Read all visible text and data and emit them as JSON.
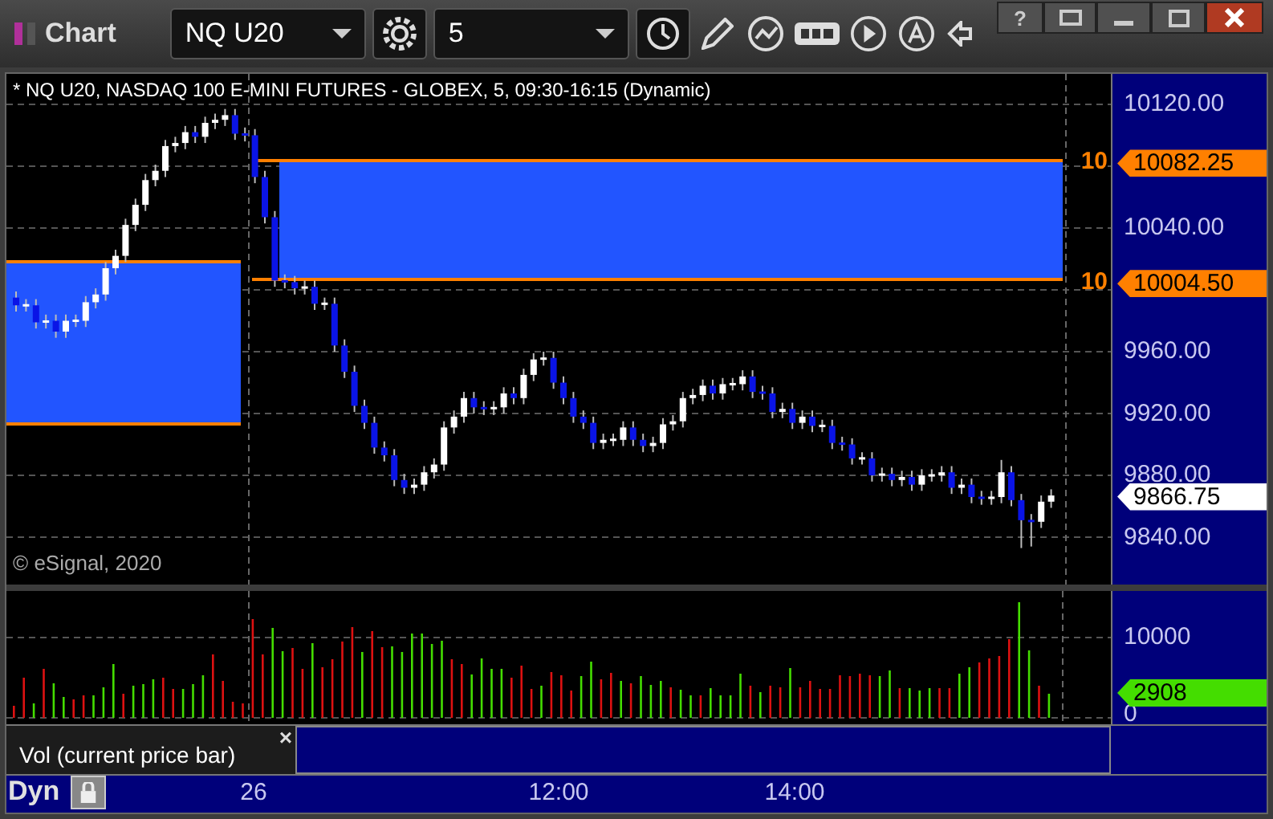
{
  "window": {
    "title": "Chart",
    "help": "?"
  },
  "toolbar": {
    "symbol": "NQ U20",
    "interval": "5"
  },
  "price_pane": {
    "title": "* NQ U20, NASDAQ 100 E-MINI FUTURES - GLOBEX, 5, 09:30-16:15 (Dynamic)",
    "copyright": "© eSignal, 2020",
    "level_tags": [
      {
        "cut_label": "10",
        "price": "10082.25"
      },
      {
        "cut_label": "10",
        "price": "10004.50"
      }
    ],
    "last_price": "9866.75",
    "chart_data": {
      "type": "candlestick",
      "ylim": [
        9809.4,
        10139.7
      ],
      "grid": true,
      "yticks": [
        {
          "value": 10120,
          "label": "10120.00"
        },
        {
          "value": 10040,
          "label": "10040.00"
        },
        {
          "value": 9960,
          "label": "9960.00"
        },
        {
          "value": 9920,
          "label": "9920.00"
        },
        {
          "value": 9880,
          "label": "9880.00"
        },
        {
          "value": 9840,
          "label": "9840.00"
        }
      ],
      "ohlc": [
        [
          9995,
          9999,
          9986,
          9990
        ],
        [
          9990,
          9994,
          9986,
          9990
        ],
        [
          9990,
          9994,
          9975,
          9979
        ],
        [
          9979,
          9984,
          9975,
          9980
        ],
        [
          9980,
          9984,
          9969,
          9973
        ],
        [
          9973,
          9984,
          9969,
          9980
        ],
        [
          9980,
          9984,
          9976,
          9980
        ],
        [
          9980,
          9996,
          9976,
          9992
        ],
        [
          9992,
          10001,
          9988,
          9997
        ],
        [
          9997,
          10018,
          9993,
          10014
        ],
        [
          10014,
          10026,
          10010,
          10022
        ],
        [
          10022,
          10046,
          10018,
          10042
        ],
        [
          10042,
          10059,
          10038,
          10055
        ],
        [
          10055,
          10075,
          10051,
          10071
        ],
        [
          10071,
          10081,
          10067,
          10077
        ],
        [
          10077,
          10097,
          10073,
          10093
        ],
        [
          10093,
          10099,
          10089,
          10095
        ],
        [
          10095,
          10106,
          10091,
          10102
        ],
        [
          10102,
          10106,
          10095,
          10099
        ],
        [
          10099,
          10112,
          10095,
          10108
        ],
        [
          10108,
          10114,
          10104,
          10110
        ],
        [
          10110,
          10117,
          10106,
          10113
        ],
        [
          10113,
          10117,
          10097,
          10101
        ],
        [
          10101,
          10105,
          10096,
          10100
        ],
        [
          10100,
          10104,
          10069,
          10073
        ],
        [
          10073,
          10077,
          10043,
          10047
        ],
        [
          10047,
          10051,
          10002,
          10006
        ],
        [
          10006,
          10010,
          10001,
          10005
        ],
        [
          10005,
          10009,
          9997,
          10001
        ],
        [
          10001,
          10006,
          9997,
          10002
        ],
        [
          10002,
          10006,
          9987,
          9991
        ],
        [
          9991,
          9995,
          9987,
          9991
        ],
        [
          9991,
          9995,
          9960,
          9964
        ],
        [
          9964,
          9968,
          9943,
          9947
        ],
        [
          9947,
          9951,
          9921,
          9925
        ],
        [
          9925,
          9929,
          9910,
          9914
        ],
        [
          9914,
          9918,
          9894,
          9898
        ],
        [
          9898,
          9902,
          9889,
          9893
        ],
        [
          9893,
          9897,
          9873,
          9877
        ],
        [
          9877,
          9881,
          9868,
          9872
        ],
        [
          9872,
          9878,
          9868,
          9874
        ],
        [
          9874,
          9886,
          9870,
          9882
        ],
        [
          9882,
          9891,
          9878,
          9887
        ],
        [
          9887,
          9915,
          9883,
          9911
        ],
        [
          9911,
          9922,
          9907,
          9918
        ],
        [
          9918,
          9934,
          9914,
          9930
        ],
        [
          9930,
          9934,
          9920,
          9924
        ],
        [
          9924,
          9928,
          9919,
          9923
        ],
        [
          9923,
          9928,
          9919,
          9924
        ],
        [
          9924,
          9937,
          9920,
          9933
        ],
        [
          9933,
          9937,
          9926,
          9930
        ],
        [
          9930,
          9949,
          9926,
          9945
        ],
        [
          9945,
          9959,
          9941,
          9955
        ],
        [
          9955,
          9960,
          9951,
          9956
        ],
        [
          9956,
          9960,
          9936,
          9940
        ],
        [
          9940,
          9944,
          9926,
          9930
        ],
        [
          9930,
          9934,
          9914,
          9918
        ],
        [
          9918,
          9922,
          9910,
          9914
        ],
        [
          9914,
          9918,
          9897,
          9901
        ],
        [
          9901,
          9907,
          9897,
          9903
        ],
        [
          9903,
          9907,
          9899,
          9903
        ],
        [
          9903,
          9915,
          9899,
          9911
        ],
        [
          9911,
          9915,
          9899,
          9903
        ],
        [
          9903,
          9907,
          9895,
          9899
        ],
        [
          9899,
          9905,
          9895,
          9901
        ],
        [
          9901,
          9917,
          9897,
          9913
        ],
        [
          9913,
          9919,
          9909,
          9915
        ],
        [
          9915,
          9934,
          9911,
          9930
        ],
        [
          9930,
          9936,
          9926,
          9932
        ],
        [
          9932,
          9942,
          9928,
          9938
        ],
        [
          9938,
          9942,
          9929,
          9933
        ],
        [
          9933,
          9943,
          9929,
          9939
        ],
        [
          9939,
          9943,
          9935,
          9939
        ],
        [
          9939,
          9948,
          9935,
          9944
        ],
        [
          9944,
          9948,
          9930,
          9934
        ],
        [
          9934,
          9938,
          9929,
          9933
        ],
        [
          9933,
          9937,
          9917,
          9921
        ],
        [
          9921,
          9927,
          9917,
          9923
        ],
        [
          9923,
          9927,
          9910,
          9914
        ],
        [
          9914,
          9922,
          9910,
          9918
        ],
        [
          9918,
          9922,
          9908,
          9912
        ],
        [
          9912,
          9916,
          9908,
          9912
        ],
        [
          9912,
          9916,
          9897,
          9901
        ],
        [
          9901,
          9905,
          9896,
          9900
        ],
        [
          9900,
          9904,
          9887,
          9891
        ],
        [
          9891,
          9895,
          9887,
          9891
        ],
        [
          9891,
          9895,
          9876,
          9880
        ],
        [
          9880,
          9885,
          9876,
          9881
        ],
        [
          9881,
          9885,
          9873,
          9877
        ],
        [
          9877,
          9883,
          9873,
          9879
        ],
        [
          9879,
          9883,
          9870,
          9874
        ],
        [
          9874,
          9884,
          9870,
          9880
        ],
        [
          9880,
          9884,
          9876,
          9880
        ],
        [
          9880,
          9886,
          9876,
          9882
        ],
        [
          9882,
          9886,
          9868,
          9872
        ],
        [
          9872,
          9878,
          9868,
          9874
        ],
        [
          9874,
          9878,
          9862,
          9866
        ],
        [
          9866,
          9870,
          9861,
          9865
        ],
        [
          9865,
          9870,
          9861,
          9866
        ],
        [
          9866,
          9890,
          9862,
          9882
        ],
        [
          9882,
          9886,
          9860,
          9864
        ],
        [
          9864,
          9868,
          9833,
          9851
        ],
        [
          9851,
          9855,
          9834,
          9850
        ],
        [
          9850,
          9867,
          9846,
          9863
        ],
        [
          9863,
          9871,
          9859,
          9867
        ]
      ]
    }
  },
  "volume_pane": {
    "last_volume": "2908",
    "chart_data": {
      "type": "bar",
      "ylim": [
        -800,
        15800
      ],
      "yticks": [
        {
          "value": 10000,
          "label": "10000"
        },
        {
          "value": 0,
          "label": "0"
        }
      ],
      "series": [
        {
          "color": "#44dd00",
          "values": [
            null,
            null,
            1800,
            null,
            4300,
            2600,
            null,
            null,
            2800,
            3800,
            6700,
            null,
            4000,
            4200,
            4800,
            null,
            null,
            3600,
            4200,
            5300,
            null,
            null,
            null,
            null,
            null,
            null,
            11200,
            8300,
            null,
            null,
            9300,
            null,
            null,
            null,
            null,
            8200,
            null,
            null,
            8900,
            8200,
            10500,
            10500,
            9200,
            9600,
            null,
            null,
            5400,
            7400,
            6100,
            6100,
            null,
            null,
            null,
            4000,
            null,
            null,
            null,
            5200,
            7000,
            null,
            null,
            4600,
            null,
            5200,
            4100,
            4600,
            null,
            3500,
            2800,
            null,
            3700,
            2800,
            2800,
            5500,
            null,
            3200,
            null,
            null,
            6200,
            null,
            null,
            null,
            null,
            null,
            null,
            null,
            null,
            5200,
            5900,
            null,
            3700,
            3400,
            3700,
            null,
            null,
            5500,
            6300,
            null,
            null,
            null,
            null,
            14400,
            8400,
            null,
            3000
          ]
        },
        {
          "color": "#dd1111",
          "values": [
            1500,
            5000,
            null,
            6100,
            null,
            null,
            2300,
            2800,
            null,
            null,
            null,
            3000,
            null,
            null,
            null,
            5000,
            3600,
            null,
            null,
            null,
            7900,
            4600,
            2000,
            1800,
            12300,
            7900,
            null,
            null,
            8700,
            6100,
            null,
            6300,
            7300,
            9500,
            11300,
            null,
            10800,
            8800,
            null,
            null,
            null,
            null,
            null,
            null,
            7300,
            6700,
            null,
            null,
            null,
            null,
            5000,
            6500,
            3600,
            null,
            5700,
            5300,
            3400,
            null,
            null,
            4800,
            5600,
            null,
            4300,
            null,
            null,
            null,
            3800,
            null,
            null,
            2800,
            null,
            null,
            null,
            null,
            4000,
            null,
            4000,
            3800,
            null,
            3800,
            4600,
            3600,
            3600,
            5300,
            5200,
            5500,
            5300,
            null,
            null,
            3700,
            null,
            null,
            null,
            3700,
            3700,
            null,
            null,
            6900,
            7400,
            7700,
            9800,
            null,
            null,
            4000,
            null
          ]
        }
      ]
    }
  },
  "indicator_label": {
    "text": "Vol (current price bar)",
    "close": "×"
  },
  "bottom_bar": {
    "mode": "Dyn",
    "time_labels": [
      "26",
      "12:00",
      "14:00"
    ]
  }
}
